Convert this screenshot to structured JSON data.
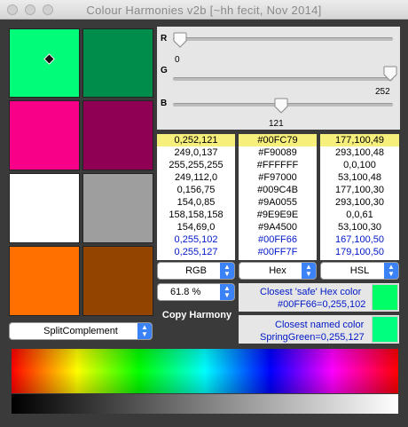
{
  "window": {
    "title": "Colour Harmonies v2b [~hh fecit, Nov 2014]"
  },
  "swatches": [
    {
      "color": "#00FC79",
      "selected": true
    },
    {
      "color": "#008C4B"
    },
    {
      "color": "#F90089"
    },
    {
      "color": "#8F0055"
    },
    {
      "color": "#FFFFFF"
    },
    {
      "color": "#9E9E9E"
    },
    {
      "color": "#FF7000"
    },
    {
      "color": "#934500"
    }
  ],
  "harmony_select": {
    "value": "SplitComplement"
  },
  "sliders": {
    "r": {
      "label": "R",
      "value": "0",
      "fraction": 0.0
    },
    "g": {
      "label": "G",
      "value": "252",
      "fraction": 0.988
    },
    "b": {
      "label": "B",
      "value": "121",
      "fraction": 0.475
    }
  },
  "lists": {
    "rgb": [
      "0,252,121",
      "249,0,137",
      "255,255,255",
      "249,112,0",
      "0,156,75",
      "154,0,85",
      "158,158,158",
      "154,69,0",
      "0,255,102",
      "0,255,127"
    ],
    "hex": [
      "#00FC79",
      "#F90089",
      "#FFFFFF",
      "#F97000",
      "#009C4B",
      "#9A0055",
      "#9E9E9E",
      "#9A4500",
      "#00FF66",
      "#00FF7F"
    ],
    "hsl": [
      "177,100,49",
      "293,100,48",
      "0,0,100",
      "53,100,48",
      "177,100,30",
      "293,100,30",
      "0,0,61",
      "53,100,30",
      "167,100,50",
      "179,100,50"
    ]
  },
  "format_selects": {
    "rgb": "RGB",
    "hex": "Hex",
    "hsl": "HSL"
  },
  "percent_select": {
    "value": "61.8 %"
  },
  "copy_button": {
    "label": "Copy Harmony"
  },
  "safe_hex": {
    "label": "Closest 'safe' Hex color",
    "value": "#00FF66=0,255,102",
    "color": "#00FF66"
  },
  "named_color": {
    "label": "Closest named color",
    "value": "SpringGreen=0,255,127",
    "color": "#00FF7F"
  }
}
